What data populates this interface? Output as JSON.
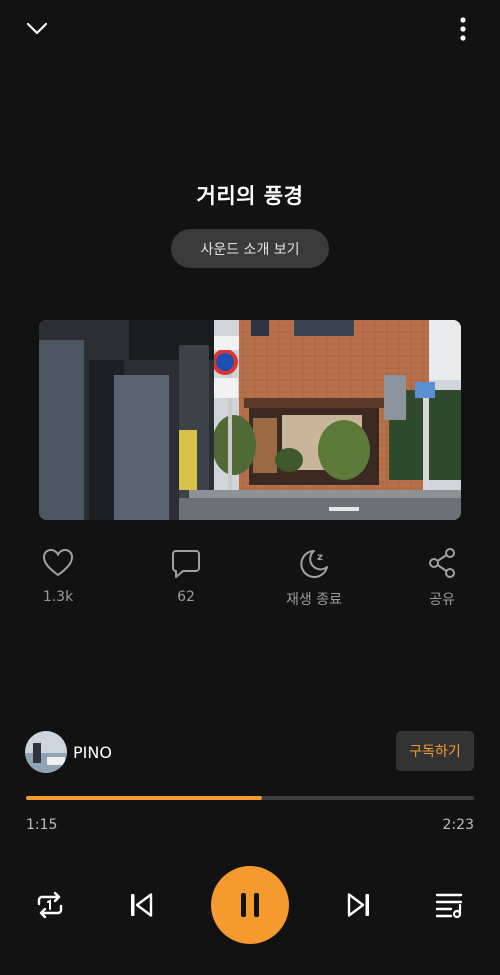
{
  "header": {
    "collapse_icon": "chevron-down-icon",
    "more_icon": "more-vertical-icon"
  },
  "track": {
    "title": "거리의 풍경",
    "intro_label": "사운드 소개 보기"
  },
  "actions": {
    "like_count": "1.3k",
    "comment_count": "62",
    "sleep_timer_label": "재생 종료",
    "share_label": "공유"
  },
  "channel": {
    "name": "PINO",
    "subscribe_label": "구독하기"
  },
  "player": {
    "current_time": "1:15",
    "total_time": "2:23",
    "progress_fraction": 0.527,
    "controls": [
      "repeat-icon",
      "previous-icon",
      "pause-icon",
      "next-icon",
      "playlist-icon"
    ]
  },
  "colors": {
    "accent": "#f59a2e",
    "background": "#121212"
  }
}
